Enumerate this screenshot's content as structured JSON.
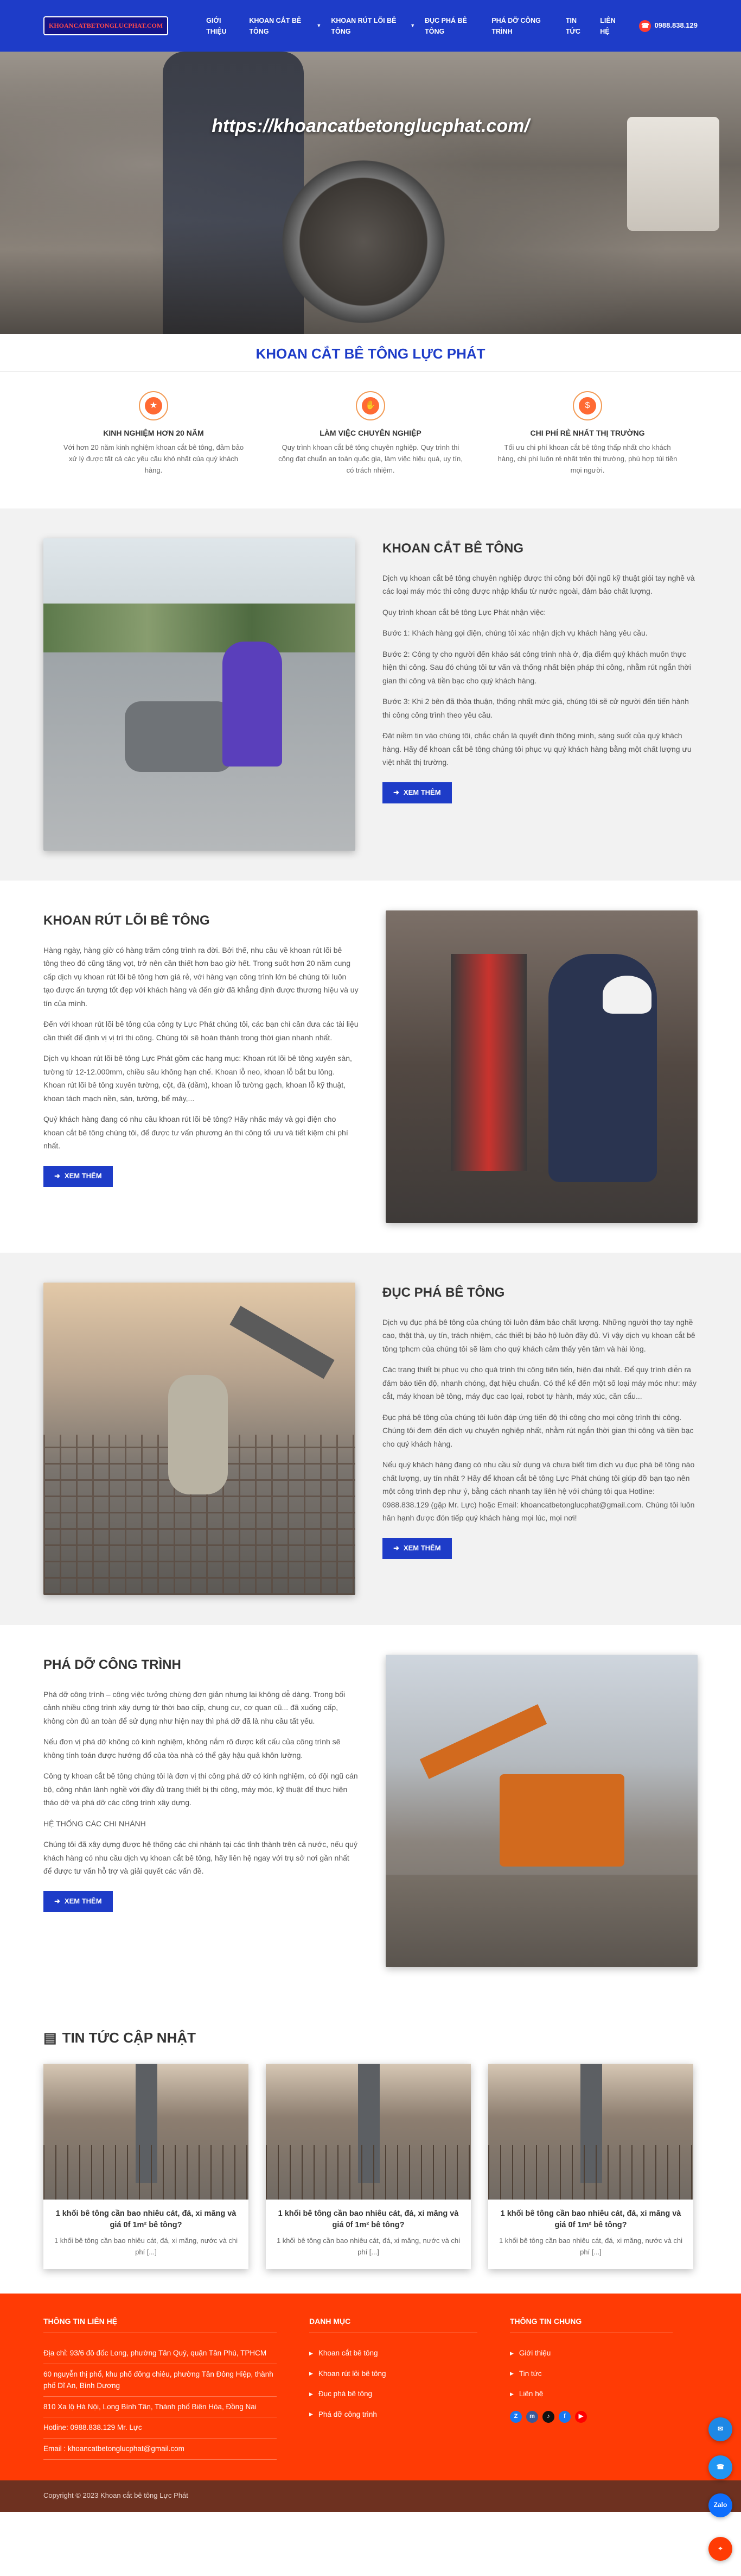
{
  "header": {
    "logo_text": "KHOANCATBETONGLUCPHAT.COM",
    "nav": [
      {
        "label": "GIỚI THIỆU",
        "has_dropdown": false
      },
      {
        "label": "KHOAN CẮT BÊ TÔNG",
        "has_dropdown": true
      },
      {
        "label": "KHOAN RÚT LÕI BÊ TÔNG",
        "has_dropdown": true
      },
      {
        "label": "ĐỤC PHÁ BÊ TÔNG",
        "has_dropdown": false
      },
      {
        "label": "PHÁ DỠ CÔNG TRÌNH",
        "has_dropdown": false
      },
      {
        "label": "TIN TỨC",
        "has_dropdown": false
      },
      {
        "label": "LIÊN HỆ",
        "has_dropdown": false
      }
    ],
    "hotline": "0988.838.129"
  },
  "hero": {
    "watermark": "https://khoancatbetonglucphat.com/"
  },
  "title_strip": "KHOAN CẮT BÊ TÔNG LỰC PHÁT",
  "features": [
    {
      "icon": "trophy-icon",
      "title": "KINH NGHIỆM HƠN 20 NĂM",
      "desc": "Với hơn 20 năm kinh nghiệm khoan cắt bê tông, đảm bảo xử lý được tất cả các yêu cầu khó nhất của quý khách hàng."
    },
    {
      "icon": "handshake-icon",
      "title": "LÀM VIỆC CHUYÊN NGHIỆP",
      "desc": "Quy trình khoan cắt bê tông chuyên nghiệp. Quy trình thi công đạt chuẩn an toàn quốc gia, làm việc hiệu quả, uy tín, có trách nhiệm."
    },
    {
      "icon": "money-icon",
      "title": "CHI PHÍ RẺ NHẤT THỊ TRƯỜNG",
      "desc": "Tối ưu chi phí khoan cắt bê tông thấp nhất cho khách hàng, chi phí luôn rẻ nhất trên thị trường, phù hợp túi tiền mọi người."
    }
  ],
  "sections": [
    {
      "title": "KHOAN CẮT BÊ TÔNG",
      "paragraphs": [
        "Dịch vụ khoan cắt bê tông chuyên nghiệp được thi công bởi đội ngũ kỹ thuật giỏi tay nghề và các loại máy móc thi công được nhập khẩu từ nước ngoài, đảm bảo chất lượng.",
        "Quy trình khoan cắt bê tông Lực Phát nhận việc:",
        "Bước 1: Khách hàng gọi điện, chúng tôi xác nhận dịch vụ khách hàng yêu cầu.",
        "Bước 2: Công ty cho người đến khảo sát công trình nhà ở, địa điểm quý khách muốn thực hiện thi công. Sau đó chúng tôi tư vấn và thống nhất biện pháp thi công, nhằm rút ngắn thời gian thi công và tiền bạc cho quý khách hàng.",
        "Bước 3: Khi 2 bên đã thỏa thuận, thống nhất mức giá, chúng tôi sẽ cử người đến tiến hành thi công công trình theo yêu cầu.",
        "Đặt niềm tin vào chúng tôi, chắc chắn là quyết định thông minh, sáng suốt của quý khách hàng. Hãy để khoan cắt bê tông chúng tôi phục vụ quý khách hàng bằng một chất lượng ưu việt nhất thị trường."
      ],
      "button": "XEM THÊM"
    },
    {
      "title": "KHOAN RÚT LÕI BÊ TÔNG",
      "paragraphs": [
        "Hàng ngày, hàng giờ có hàng trăm công trình ra đời. Bởi thế, nhu cầu về khoan rút lõi bê tông theo đó cũng tăng vọt, trở nên cần thiết hơn bao giờ hết. Trong suốt hơn 20 năm cung cấp dịch vụ khoan rút lõi bê tông hơn giá rẻ, với hàng vạn công trình lớn bé chúng tôi luôn tạo được ấn tượng tốt đẹp với khách hàng và đến giờ đã khẳng định được thương hiệu và uy tín của mình.",
        "Đến với khoan rút lõi bê tông của công ty Lực Phát chúng tôi, các bạn chỉ cần đưa các tài liệu cần thiết để định vị vị trí thi công. Chúng tôi sẽ hoàn thành trong thời gian nhanh nhất.",
        "Dịch vụ khoan rút lõi bê tông Lực Phát gồm các hạng mục: Khoan rút lõi bê tông xuyên sàn, tường từ 12-12.000mm, chiều sâu không hạn chế. Khoan lỗ neo, khoan lỗ bắt bu lông. Khoan rút lõi bê tông xuyên tường, cột, đà (dầm), khoan lỗ tường gạch, khoan lỗ kỹ thuật, khoan tách mạch nền, sàn, tường, bể máy,...",
        "Quý khách hàng đang có nhu cầu khoan rút lõi bê tông? Hãy nhấc máy và gọi điện cho khoan cắt bê tông chúng tôi, để được tư vấn phương án thi công tối ưu và tiết kiệm chi phí nhất."
      ],
      "button": "XEM THÊM"
    },
    {
      "title": "ĐỤC PHÁ BÊ TÔNG",
      "paragraphs": [
        "Dịch vụ đục phá bê tông của chúng tôi luôn đảm bảo chất lượng. Những người thợ tay nghề cao, thật thà, uy tín, trách nhiệm, các thiết bị bảo hộ luôn đầy đủ. Vì vậy dịch vụ khoan cắt bê tông tphcm của chúng tôi sẽ làm cho quý khách cảm thấy yên tâm và hài lòng.",
        "Các trang thiết bị phục vụ cho quá trình thi công tiên tiến, hiện đại nhất. Để quy trình diễn ra đảm bảo tiến độ, nhanh chóng, đạt hiệu chuẩn. Có thể kể đến một số loại máy móc như: máy cắt, máy khoan bê tông, máy đục cao lọai, robot tự hành, máy xúc, cần cẩu...",
        "Đục phá bê tông của chúng tôi luôn đáp ứng tiến độ thi công cho mọi công trình thi công. Chúng tôi đem đến dịch vụ chuyên nghiệp nhất, nhằm rút ngắn thời gian thi công và tiền bạc cho quý khách hàng.",
        "Nếu quý khách hàng đang có nhu cầu sử dụng và chưa biết tìm dịch vụ đục phá bê tông nào chất lượng, uy tín nhất ? Hãy để khoan cắt bê tông Lực Phát chúng tôi giúp đỡ bạn tạo nên một công trình đẹp như ý, bằng cách nhanh tay liên hệ với chúng tôi qua Hotline: 0988.838.129 (gặp Mr. Lực) hoặc Email: khoancatbetonglucphat@gmail.com. Chúng tôi luôn hân hạnh được đón tiếp quý khách hàng mọi lúc, mọi nơi!"
      ],
      "button": "XEM THÊM"
    },
    {
      "title": "PHÁ DỠ CÔNG TRÌNH",
      "paragraphs": [
        "Phá dỡ công trình – công việc tưởng chừng đơn giản nhưng lại không dễ dàng. Trong bối cảnh nhiều công trình xây dựng từ thời bao cấp, chung cư, cơ quan cũ... đã xuống cấp, không còn đủ an toàn để sử dụng như hiện nay thì phá dỡ đã là nhu cầu tất yếu.",
        "Nếu đơn vị phá dỡ không có kinh nghiệm, không nắm rõ được kết cấu của công trình sẽ không tính toán được hướng đổ của tòa nhà có thể gây hậu quả khôn lường.",
        "Công ty khoan cắt bê tông chúng tôi là đơn vị thi công phá dỡ có kinh nghiệm, có đội ngũ cán bộ, công nhân lành nghề với đầy đủ trang thiết bị thi công, máy móc, kỹ thuật để thực hiện tháo dỡ và phá dỡ các công trình xây dựng.",
        "HỆ THỐNG CÁC CHI NHÁNH",
        "Chúng tôi đã xây dựng được hệ thống các chi nhánh tại các tỉnh thành trên cả nước, nếu quý khách hàng có nhu cầu dịch vụ khoan cắt bê tông, hãy liên hệ ngay với trụ sở nơi gần nhất để được tư vấn hỗ trợ và giải quyết các vấn đề."
      ],
      "button": "XEM THÊM"
    }
  ],
  "news": {
    "title": "TIN TỨC CẬP NHẬT",
    "items": [
      {
        "title": "1 khối bê tông cần bao nhiêu cát, đá, xi măng và giá 0f 1m² bê tông?",
        "excerpt": "1 khối bê tông cần bao nhiêu cát, đá, xi măng, nước và chi phí [...]"
      },
      {
        "title": "1 khối bê tông cần bao nhiêu cát, đá, xi măng và giá 0f 1m² bê tông?",
        "excerpt": "1 khối bê tông cần bao nhiêu cát, đá, xi măng, nước và chi phí [...]"
      },
      {
        "title": "1 khối bê tông cần bao nhiêu cát, đá, xi măng và giá 0f 1m² bê tông?",
        "excerpt": "1 khối bê tông cần bao nhiêu cát, đá, xi măng, nước và chi phí [...]"
      }
    ]
  },
  "footer": {
    "contact_title": "THÔNG TIN LIÊN HỆ",
    "contact_lines": [
      "Địa chỉ: 93/6 đô đốc Long, phường Tân Quý, quận Tân Phú, TPHCM",
      "60 nguyễn thị phổ, khu phố đông chiêu, phường Tân Đông Hiệp, thành phố Dĩ An, Bình Dương",
      "810 Xa lộ Hà Nội, Long Bình Tân, Thành phố Biên Hòa, Đồng Nai",
      "Hotline: 0988.838.129 Mr. Lực",
      "Email : khoancatbetonglucphat@gmail.com"
    ],
    "category_title": "DANH MỤC",
    "categories": [
      "Khoan cắt bê tông",
      "Khoan rút lõi bê tông",
      "Đục phá bê tông",
      "Phá dỡ công trình"
    ],
    "info_title": "THÔNG TIN CHUNG",
    "info_links": [
      "Giới thiệu",
      "Tin tức",
      "Liên hệ"
    ],
    "social": [
      {
        "icon": "zalo-icon",
        "color": "#1877f2"
      },
      {
        "icon": "messenger-icon",
        "color": "#3b5998"
      },
      {
        "icon": "tiktok-icon",
        "color": "#111111"
      },
      {
        "icon": "facebook-icon",
        "color": "#1877f2"
      },
      {
        "icon": "youtube-icon",
        "color": "#ff0000"
      }
    ],
    "copyright": "Copyright © 2023 Khoan cắt bê tông Lực Phát"
  },
  "floating": [
    {
      "icon": "messenger-float-icon",
      "color": "#1e88e5"
    },
    {
      "icon": "phone-float-icon",
      "color": "#2196f3"
    },
    {
      "icon": "zalo-float-icon",
      "color": "#0d6efd",
      "label": "Zalo"
    },
    {
      "icon": "map-float-icon",
      "color": "#ff3b05"
    }
  ]
}
